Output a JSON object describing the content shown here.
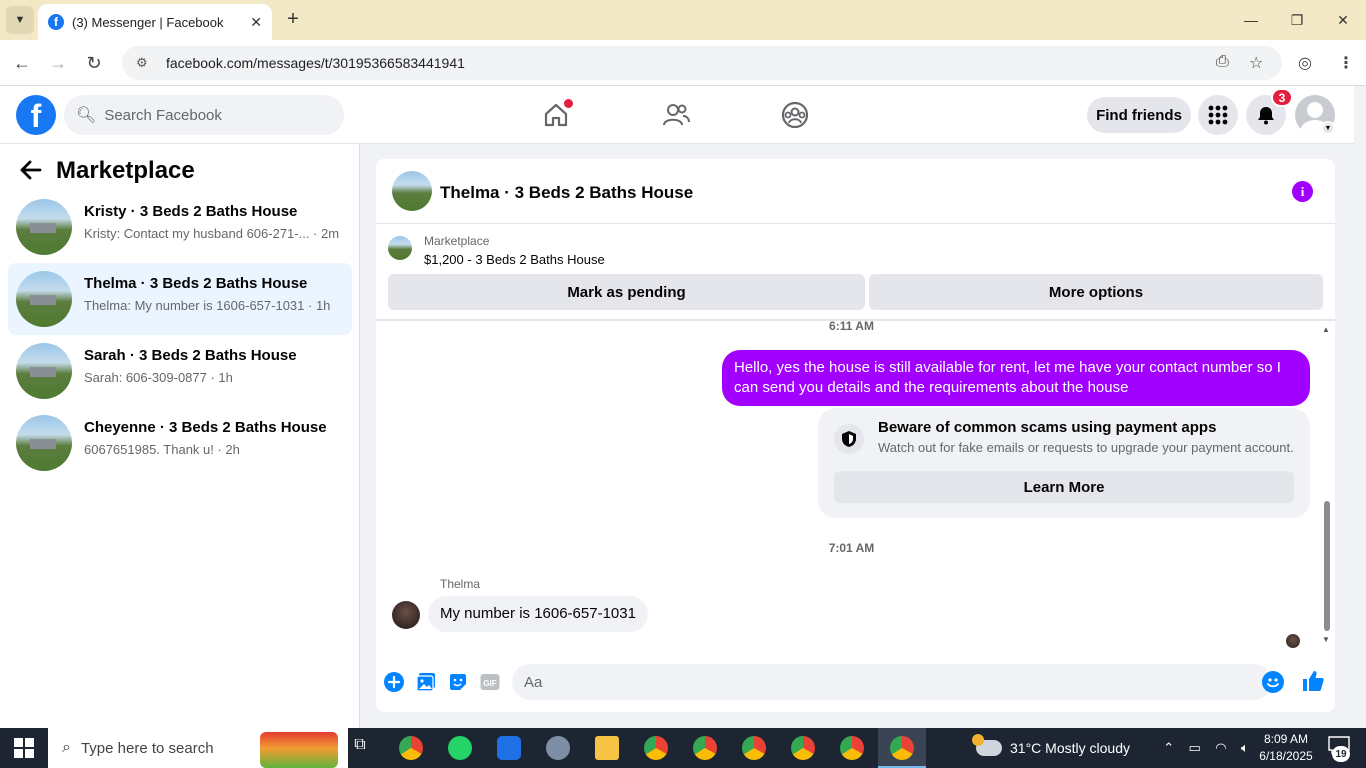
{
  "browser": {
    "tab_title": "(3) Messenger | Facebook",
    "url": "facebook.com/messages/t/30195366583441941"
  },
  "header": {
    "search_placeholder": "Search Facebook",
    "find_friends": "Find friends",
    "notification_count": "3",
    "accent_color": "#1877f2"
  },
  "sidebar": {
    "title": "Marketplace",
    "conversations": [
      {
        "name": "Kristy · 3 Beds 2 Baths House",
        "snippet": "Kristy: Contact my husband 606-271-... · 2m",
        "selected": false
      },
      {
        "name": "Thelma · 3 Beds 2 Baths House",
        "snippet": "Thelma: My number is 1606-657-1031 · 1h",
        "selected": true
      },
      {
        "name": "Sarah · 3 Beds 2 Baths House",
        "snippet": "Sarah: 606-309-0877 · 1h",
        "selected": false
      },
      {
        "name": "Cheyenne · 3 Beds 2 Baths House",
        "snippet": "6067651985. Thank u! · 2h",
        "selected": false
      }
    ]
  },
  "chat": {
    "title": "Thelma · 3 Beds 2 Baths House",
    "listing_label": "Marketplace",
    "listing_price": "$1,200 - 3 Beds 2 Baths House",
    "mark_pending": "Mark as pending",
    "more_options": "More options",
    "time_1": "6:11 AM",
    "outgoing_message": "Hello, yes the house is still available for rent, let me have your contact number so I can send you details and the requirements about the house",
    "scam_title": "Beware of common scams using payment apps",
    "scam_body": "Watch out for fake emails or requests to upgrade your payment account.",
    "learn_more": "Learn More",
    "time_2": "7:01 AM",
    "sender": "Thelma",
    "incoming_message": "My number is 1606-657-1031",
    "compose_placeholder": "Aa",
    "accent_color": "#a100ff"
  },
  "taskbar": {
    "search_placeholder": "Type here to search",
    "weather": "31°C  Mostly cloudy",
    "time": "8:09 AM",
    "date": "6/18/2025",
    "notifications": "19"
  }
}
